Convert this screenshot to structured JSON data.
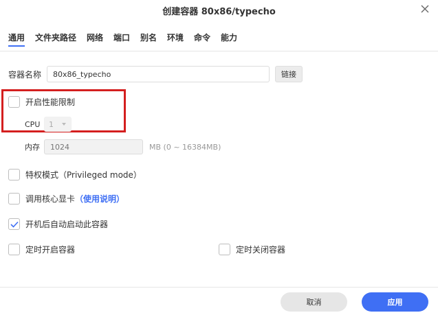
{
  "dialog": {
    "title": "创建容器 80x86/typecho"
  },
  "tabs": [
    {
      "label": "通用",
      "active": true
    },
    {
      "label": "文件夹路径"
    },
    {
      "label": "网络"
    },
    {
      "label": "端口"
    },
    {
      "label": "别名"
    },
    {
      "label": "环境"
    },
    {
      "label": "命令"
    },
    {
      "label": "能力"
    }
  ],
  "form": {
    "container_name_label": "容器名称",
    "container_name_value": "80x86_typecho",
    "link_button": "链接",
    "perf_limit_label": "开启性能限制",
    "perf_limit_checked": false,
    "cpu_label": "CPU",
    "cpu_value": "1",
    "memory_label": "内存",
    "memory_placeholder": "1024",
    "memory_hint": "MB (0 ~ 16384MB)",
    "privileged_label": "特权模式（Privileged mode）",
    "privileged_checked": false,
    "gpu_label": "调用核心显卡",
    "gpu_help": "（使用说明）",
    "gpu_checked": false,
    "autostart_label": "开机后自动启动此容器",
    "autostart_checked": true,
    "scheduled_start_label": "定时开启容器",
    "scheduled_start_checked": false,
    "scheduled_stop_label": "定时关闭容器",
    "scheduled_stop_checked": false
  },
  "footer": {
    "cancel": "取消",
    "apply": "应用"
  },
  "colors": {
    "accent": "#3f6ff4",
    "highlight_box": "#d41f1f"
  },
  "icons": {
    "close": "close-icon",
    "check": "check-icon",
    "caret": "caret-down-icon"
  }
}
